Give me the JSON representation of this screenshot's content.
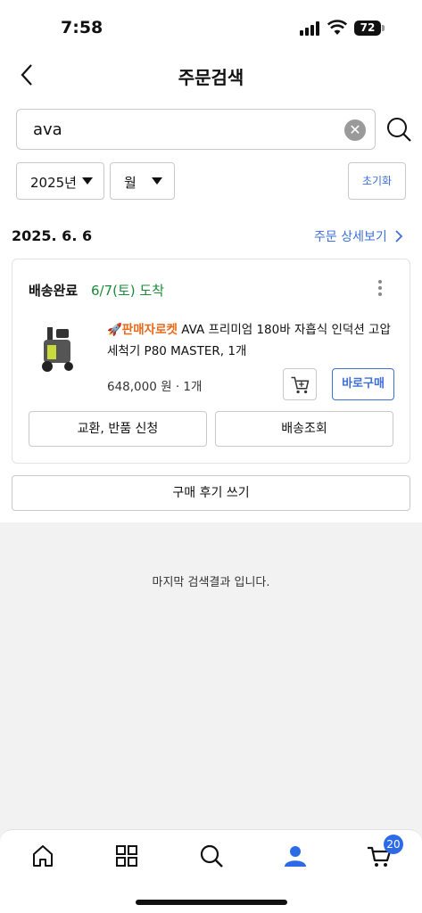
{
  "status_bar": {
    "time": "7:58",
    "battery": "72"
  },
  "header": {
    "title": "주문검색"
  },
  "search": {
    "value": "ava"
  },
  "filters": {
    "year": "2025년",
    "month": "월",
    "reset_label": "초기화"
  },
  "order": {
    "date": "2025. 6. 6",
    "detail_link": "주문 상세보기",
    "status": "배송완료",
    "arrival": "6/7(토) 도착",
    "product": {
      "badge": "🚀판매자로켓",
      "name": "AVA 프리미엄 180바 자흡식 인덕션 고압세척기 P80 MASTER, 1개",
      "price": "648,000 원 · 1개"
    },
    "buy_now_label": "바로구매",
    "exchange_label": "교환, 반품 신청",
    "tracking_label": "배송조회",
    "review_label": "구매 후기 쓰기"
  },
  "end_message": "마지막 검색결과 입니다.",
  "tabbar": {
    "cart_count": "20",
    "items": [
      "home-icon",
      "categories-icon",
      "search-icon",
      "my-page-icon",
      "cart-icon"
    ],
    "active_color": "#2d6ae6"
  },
  "colors": {
    "link": "#3d6fd8",
    "arrival": "#1a8a3a",
    "rocket": "#e8691a"
  }
}
